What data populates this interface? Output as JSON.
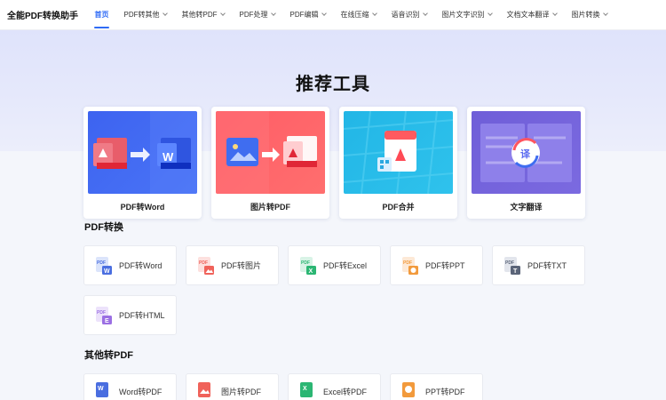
{
  "nav": {
    "brand": "全能PDF转换助手",
    "items": [
      {
        "label": "首页",
        "active": true,
        "dropdown": false
      },
      {
        "label": "PDF转其他",
        "dropdown": true
      },
      {
        "label": "其他转PDF",
        "dropdown": true
      },
      {
        "label": "PDF处理",
        "dropdown": true
      },
      {
        "label": "PDF编辑",
        "dropdown": true
      },
      {
        "label": "在线压缩",
        "dropdown": true
      },
      {
        "label": "语音识别",
        "dropdown": true
      },
      {
        "label": "图片文字识别",
        "dropdown": true
      },
      {
        "label": "文档文本翻译",
        "dropdown": true
      },
      {
        "label": "图片转换",
        "dropdown": true
      }
    ]
  },
  "hero": {
    "title": "推荐工具"
  },
  "featured": [
    {
      "label": "PDF转Word",
      "icon": "pdf-to-word-illustration"
    },
    {
      "label": "图片转PDF",
      "icon": "image-to-pdf-illustration"
    },
    {
      "label": "PDF合并",
      "icon": "pdf-merge-illustration"
    },
    {
      "label": "文字翻译",
      "icon": "translate-illustration"
    }
  ],
  "sections": [
    {
      "title": "PDF转换",
      "tools": [
        {
          "label": "PDF转Word",
          "icon": "pdf-word-icon",
          "color": "#4a6ee0"
        },
        {
          "label": "PDF转图片",
          "icon": "pdf-image-icon",
          "color": "#f0625a"
        },
        {
          "label": "PDF转Excel",
          "icon": "pdf-excel-icon",
          "color": "#2bb673"
        },
        {
          "label": "PDF转PPT",
          "icon": "pdf-ppt-icon",
          "color": "#f29a3c"
        },
        {
          "label": "PDF转TXT",
          "icon": "pdf-txt-icon",
          "color": "#5a6478"
        },
        {
          "label": "PDF转HTML",
          "icon": "pdf-html-icon",
          "color": "#9b6fe3"
        }
      ]
    },
    {
      "title": "其他转PDF",
      "tools": [
        {
          "label": "Word转PDF",
          "icon": "word-pdf-icon",
          "color": "#4a6ee0"
        },
        {
          "label": "图片转PDF",
          "icon": "image-pdf-icon",
          "color": "#f0625a"
        },
        {
          "label": "Excel转PDF",
          "icon": "excel-pdf-icon",
          "color": "#2bb673"
        },
        {
          "label": "PPT转PDF",
          "icon": "ppt-pdf-icon",
          "color": "#f29a3c"
        }
      ]
    }
  ]
}
